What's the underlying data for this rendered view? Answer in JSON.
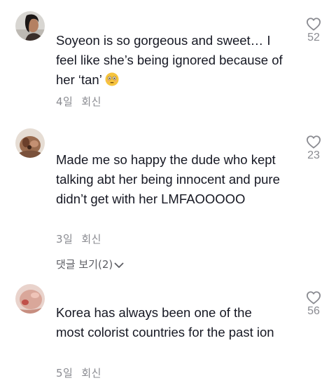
{
  "comments": [
    {
      "text": "Soyeon is so gorgeous and sweet… I feel like she’s being ignored because of her ‘tan’",
      "emoji": "flushed-face-emoji",
      "time": "4일",
      "reply_label": "회신",
      "likes": "52",
      "avatar": "avatar-woman-dark-hair-icon"
    },
    {
      "text": "Made me so happy the dude who kept talking abt her being innocent and pure didn’t get with her LMFAOOOOO",
      "time": "3일",
      "reply_label": "회신",
      "likes": "23",
      "view_replies": "댓글 보기(2)",
      "avatar": "avatar-brown-icon"
    },
    {
      "text": "Korea has always been one of the most colorist countries for the past ion",
      "time": "5일",
      "reply_label": "회신",
      "likes": "56",
      "avatar": "avatar-face-closeup-icon"
    }
  ],
  "colors": {
    "text": "#161823",
    "muted": "#8a8b91",
    "heart_outline": "#8a8b91"
  }
}
